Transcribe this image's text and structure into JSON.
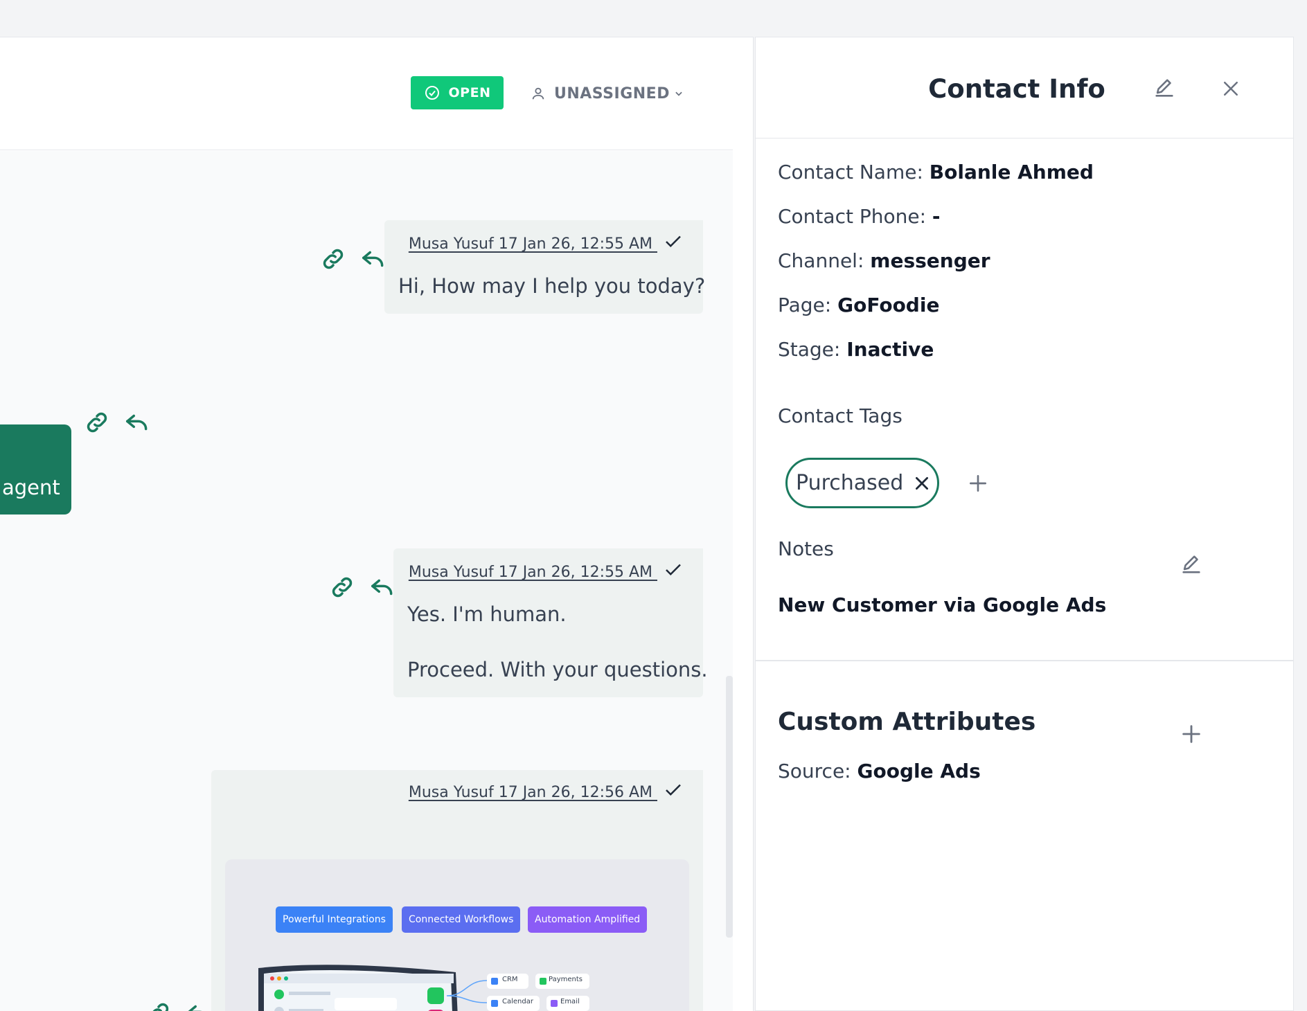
{
  "header": {
    "status_label": "OPEN",
    "assignee_label": "UNASSIGNED"
  },
  "colors": {
    "accent_green": "#10c87a",
    "dark_green": "#1a7a5e"
  },
  "messages": [
    {
      "direction": "out",
      "meta": "Musa Yusuf 17 Jan 26, 12:55 AM ",
      "lines": [
        "Hi, How may I help you today?"
      ]
    },
    {
      "direction": "in",
      "lines": [
        "agent"
      ]
    },
    {
      "direction": "out",
      "meta": "Musa Yusuf 17 Jan 26, 12:55 AM ",
      "lines": [
        "Yes. I'm human.",
        "Proceed. With your questions."
      ]
    },
    {
      "direction": "out",
      "meta": "Musa Yusuf 17 Jan 26, 12:56 AM ",
      "lines": []
    }
  ],
  "image_preview": {
    "pills": [
      "Powerful Integrations",
      "Connected Workflows",
      "Automation Amplified"
    ],
    "cards": [
      "CRM",
      "Payments",
      "Calendar",
      "Email"
    ]
  },
  "contact": {
    "title": "Contact Info",
    "fields": [
      {
        "label": "Contact Name: ",
        "value": "Bolanle Ahmed"
      },
      {
        "label": "Contact Phone: ",
        "value": "-"
      },
      {
        "label": "Channel: ",
        "value": "messenger"
      },
      {
        "label": "Page: ",
        "value": "GoFoodie"
      },
      {
        "label": "Stage: ",
        "value": "Inactive"
      }
    ],
    "tags_label": "Contact Tags",
    "tags": [
      "Purchased"
    ],
    "notes_label": "Notes",
    "notes_value": "New Customer via Google Ads",
    "custom_attributes_title": "Custom Attributes",
    "custom_attributes": [
      {
        "label": "Source: ",
        "value": "Google Ads"
      }
    ]
  }
}
